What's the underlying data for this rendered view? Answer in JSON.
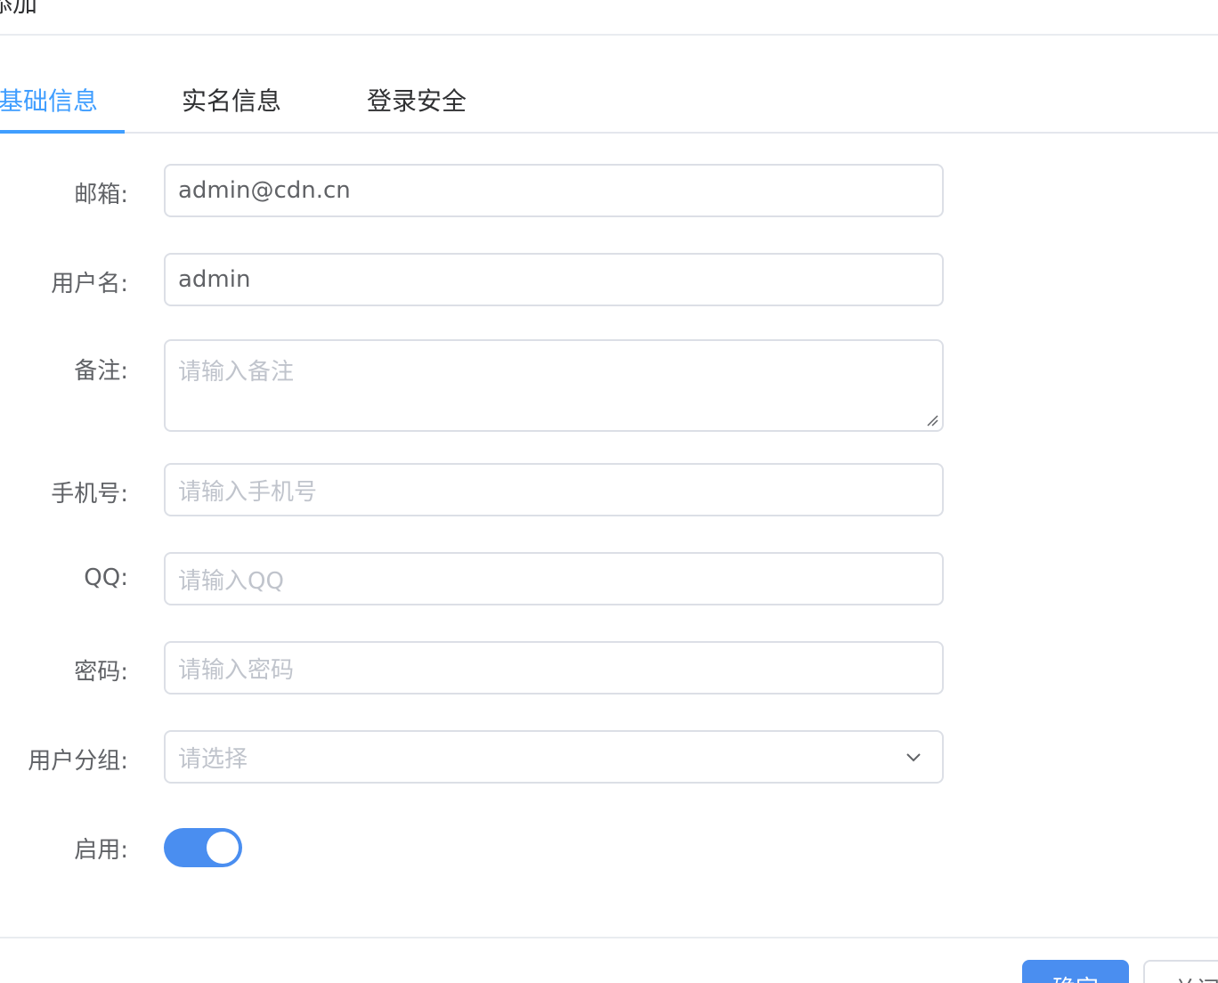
{
  "dialog": {
    "title": "添加"
  },
  "tabs": [
    {
      "label": "基础信息",
      "active": true
    },
    {
      "label": "实名信息",
      "active": false
    },
    {
      "label": "登录安全",
      "active": false
    }
  ],
  "form": {
    "email": {
      "label": "邮箱:",
      "value": "admin@cdn.cn"
    },
    "username": {
      "label": "用户名:",
      "value": "admin"
    },
    "remark": {
      "label": "备注:",
      "placeholder": "请输入备注"
    },
    "phone": {
      "label": "手机号:",
      "placeholder": "请输入手机号"
    },
    "qq": {
      "label": "QQ:",
      "placeholder": "请输入QQ"
    },
    "password": {
      "label": "密码:",
      "placeholder": "请输入密码"
    },
    "group": {
      "label": "用户分组:",
      "placeholder": "请选择"
    },
    "enabled": {
      "label": "启用:",
      "value": true
    }
  },
  "footer": {
    "confirm_label": "确定",
    "close_label": "关闭"
  },
  "colors": {
    "primary": "#409eff",
    "switch_on": "#4a8ef0",
    "border": "#dcdfe6",
    "placeholder": "#c0c4cc"
  },
  "icons": {
    "select_arrow": "chevron-down-icon",
    "resize": "resize-grip-icon"
  }
}
